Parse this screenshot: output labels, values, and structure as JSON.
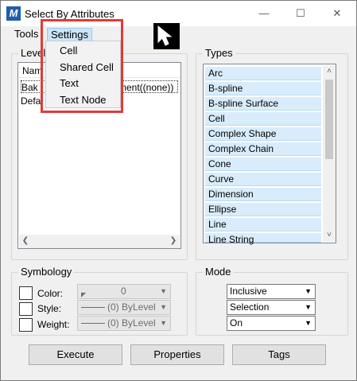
{
  "window": {
    "title": "Select By Attributes",
    "app_icon_letter": "M",
    "controls": {
      "minimize": "—",
      "maximize": "☐",
      "close": "✕"
    }
  },
  "menubar": {
    "tools": "Tools",
    "settings": "Settings"
  },
  "settings_menu": {
    "items": [
      "Cell",
      "Shared Cell",
      "Text",
      "Text Node"
    ]
  },
  "levels": {
    "label": "Levels",
    "column_header": "Nam",
    "rows": [
      {
        "left": "Bak",
        "right": "ment((none))"
      },
      {
        "left": "Defa",
        "right": ""
      }
    ]
  },
  "types": {
    "label": "Types",
    "items": [
      "Arc",
      "B-spline",
      "B-spline Surface",
      "Cell",
      "Complex Shape",
      "Complex Chain",
      "Cone",
      "Curve",
      "Dimension",
      "Ellipse",
      "Line",
      "Line String"
    ]
  },
  "symbology": {
    "label": "Symbology",
    "color_label": "Color:",
    "style_label": "Style:",
    "weight_label": "Weight:",
    "color_value": "0",
    "style_value": "(0) ByLevel",
    "weight_value": "(0) ByLevel"
  },
  "mode": {
    "label": "Mode",
    "mode_value": "Inclusive",
    "type_value": "Selection",
    "state_value": "On"
  },
  "buttons": {
    "execute": "Execute",
    "properties": "Properties",
    "tags": "Tags"
  },
  "colors": {
    "highlight_outline": "#e53935",
    "list_selection_bg": "#d9ecfb",
    "menu_hover": "#cce4f7"
  }
}
